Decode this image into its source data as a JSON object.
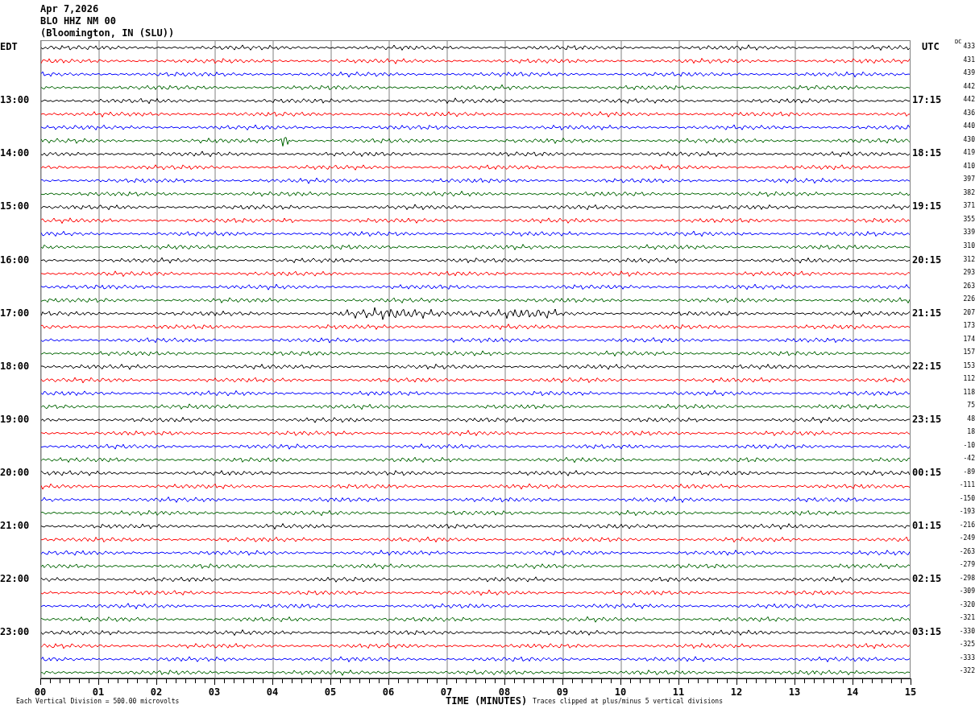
{
  "header": {
    "date": "Apr 7,2026",
    "station": "BLO HHZ NM 00",
    "location": "(Bloomington, IN (SLU))"
  },
  "left_axis_title": "EDT",
  "right_axis_title": "UTC",
  "dc_title": "DC",
  "rows": [
    {
      "dc": "433",
      "color": "#000000"
    },
    {
      "dc": "431",
      "color": "#ff0000"
    },
    {
      "dc": "439",
      "color": "#0000ff"
    },
    {
      "dc": "442",
      "color": "#006400"
    },
    {
      "local": "13:00",
      "utc": "17:15",
      "dc": "442",
      "color": "#000000"
    },
    {
      "dc": "436",
      "color": "#ff0000"
    },
    {
      "dc": "440",
      "color": "#0000ff"
    },
    {
      "dc": "430",
      "color": "#006400"
    },
    {
      "local": "14:00",
      "utc": "18:15",
      "dc": "419",
      "color": "#000000"
    },
    {
      "dc": "410",
      "color": "#ff0000"
    },
    {
      "dc": "397",
      "color": "#0000ff"
    },
    {
      "dc": "382",
      "color": "#006400"
    },
    {
      "local": "15:00",
      "utc": "19:15",
      "dc": "371",
      "color": "#000000"
    },
    {
      "dc": "355",
      "color": "#ff0000"
    },
    {
      "dc": "339",
      "color": "#0000ff"
    },
    {
      "dc": "310",
      "color": "#006400"
    },
    {
      "local": "16:00",
      "utc": "20:15",
      "dc": "312",
      "color": "#000000"
    },
    {
      "dc": "293",
      "color": "#ff0000"
    },
    {
      "dc": "263",
      "color": "#0000ff"
    },
    {
      "dc": "226",
      "color": "#006400"
    },
    {
      "local": "17:00",
      "utc": "21:15",
      "dc": "207",
      "color": "#000000"
    },
    {
      "dc": "173",
      "color": "#ff0000"
    },
    {
      "dc": "174",
      "color": "#0000ff"
    },
    {
      "dc": "157",
      "color": "#006400"
    },
    {
      "local": "18:00",
      "utc": "22:15",
      "dc": "153",
      "color": "#000000"
    },
    {
      "dc": "112",
      "color": "#ff0000"
    },
    {
      "dc": "118",
      "color": "#0000ff"
    },
    {
      "dc": "75",
      "color": "#006400"
    },
    {
      "local": "19:00",
      "utc": "23:15",
      "dc": "48",
      "color": "#000000"
    },
    {
      "dc": "18",
      "color": "#ff0000"
    },
    {
      "dc": "-10",
      "color": "#0000ff"
    },
    {
      "dc": "-42",
      "color": "#006400"
    },
    {
      "local": "20:00",
      "utc": "00:15",
      "dc": "-89",
      "color": "#000000"
    },
    {
      "dc": "-111",
      "color": "#ff0000"
    },
    {
      "dc": "-150",
      "color": "#0000ff"
    },
    {
      "dc": "-193",
      "color": "#006400"
    },
    {
      "local": "21:00",
      "utc": "01:15",
      "dc": "-216",
      "color": "#000000"
    },
    {
      "dc": "-249",
      "color": "#ff0000"
    },
    {
      "dc": "-263",
      "color": "#0000ff"
    },
    {
      "dc": "-279",
      "color": "#006400"
    },
    {
      "local": "22:00",
      "utc": "02:15",
      "dc": "-298",
      "color": "#000000"
    },
    {
      "dc": "-309",
      "color": "#ff0000"
    },
    {
      "dc": "-320",
      "color": "#0000ff"
    },
    {
      "dc": "-321",
      "color": "#006400"
    },
    {
      "local": "23:00",
      "utc": "03:15",
      "dc": "-330",
      "color": "#000000"
    },
    {
      "dc": "-325",
      "color": "#ff0000"
    },
    {
      "dc": "-333",
      "color": "#0000ff"
    },
    {
      "dc": "-322",
      "color": "#006400"
    }
  ],
  "minute_labels": [
    "00",
    "01",
    "02",
    "03",
    "04",
    "05",
    "06",
    "07",
    "08",
    "09",
    "10",
    "11",
    "12",
    "13",
    "14",
    "15"
  ],
  "footer": {
    "scale_note": "Each Vertical Division =  500.00 microvolts",
    "axis_title": "TIME (MINUTES)",
    "clip_note": "Traces clipped at plus/minus 5 vertical divisions"
  }
}
